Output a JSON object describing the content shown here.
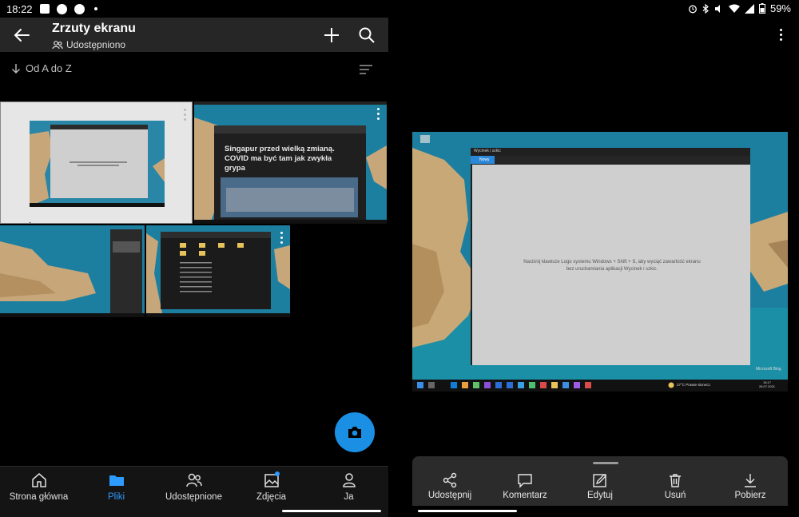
{
  "status_left": {
    "time": "18:22"
  },
  "status_right": {
    "battery": "59%"
  },
  "header": {
    "title": "Zrzuty ekranu",
    "subtitle": "Udostępniono"
  },
  "sort": {
    "label": "Od A do Z"
  },
  "thumbnails": [
    {
      "title_text": "Singapur przed wielką zmianą. COVID ma być tam jak zwykła grypa"
    }
  ],
  "bottom_nav": [
    {
      "label": "Strona główna",
      "icon": "home-icon",
      "active": false
    },
    {
      "label": "Pliki",
      "icon": "folder-icon",
      "active": true
    },
    {
      "label": "Udostępnione",
      "icon": "people-icon",
      "active": false
    },
    {
      "label": "Zdjęcia",
      "icon": "photo-icon",
      "active": false
    },
    {
      "label": "Ja",
      "icon": "person-icon",
      "active": false
    }
  ],
  "preview": {
    "window_title": "Wycinek i szkic",
    "tab_label": "Nowy",
    "message": "Naciśnij klawisze Logo systemu Windows + Shift + S, aby wyciąć zawartość ekranu bez uruchamiania aplikacji Wycinek i szkic.",
    "watermark": "Microsoft Bing",
    "weather": "27°C Prawie słonecz.",
    "clock_time": "18:17",
    "clock_date": "28.07.2021"
  },
  "actions": [
    {
      "label": "Udostępnij",
      "icon": "share-icon"
    },
    {
      "label": "Komentarz",
      "icon": "comment-icon"
    },
    {
      "label": "Edytuj",
      "icon": "edit-icon"
    },
    {
      "label": "Usuń",
      "icon": "trash-icon"
    },
    {
      "label": "Pobierz",
      "icon": "download-icon"
    }
  ],
  "colors": {
    "accent": "#2e9bff",
    "fab": "#1a8fe3",
    "header_bg": "#262626",
    "sea": "#1d7fa0",
    "dialog_gray": "#cfcfcf"
  }
}
